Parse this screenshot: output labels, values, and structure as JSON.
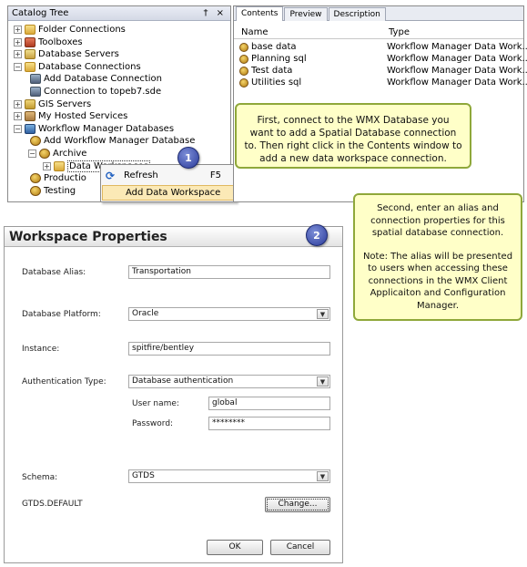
{
  "catalog": {
    "header_title": "Catalog Tree",
    "header_icons": "† ×",
    "items": [
      {
        "expander": "+",
        "icon": "folder",
        "label": "Folder Connections"
      },
      {
        "expander": "+",
        "icon": "toolbox",
        "label": "Toolboxes"
      },
      {
        "expander": "+",
        "icon": "dbserver",
        "label": "Database Servers"
      },
      {
        "expander": "−",
        "icon": "folder",
        "label": "Database Connections"
      },
      {
        "expander": "",
        "icon": "conn",
        "label": "Add Database Connection"
      },
      {
        "expander": "",
        "icon": "conn",
        "label": "Connection to topeb7.sde"
      },
      {
        "expander": "+",
        "icon": "gis",
        "label": "GIS Servers"
      },
      {
        "expander": "+",
        "icon": "hosted",
        "label": "My Hosted Services"
      },
      {
        "expander": "−",
        "icon": "wmx",
        "label": "Workflow Manager Databases"
      },
      {
        "expander": "",
        "icon": "db",
        "label": "Add Workflow Manager Database"
      },
      {
        "expander": "−",
        "icon": "db",
        "label": "Archive"
      },
      {
        "expander": "+",
        "icon": "folder",
        "label": "Data Workspaces"
      },
      {
        "expander": "",
        "icon": "db",
        "label": "Productio"
      },
      {
        "expander": "",
        "icon": "db",
        "label": "Testing"
      }
    ]
  },
  "context_menu": {
    "refresh_label": "Refresh",
    "refresh_key": "F5",
    "add_label": "Add Data Workspace"
  },
  "contents": {
    "tabs": [
      "Contents",
      "Preview",
      "Description"
    ],
    "columns": {
      "name": "Name",
      "type": "Type"
    },
    "rows": [
      {
        "name": "base data",
        "type": "Workflow Manager Data Work..."
      },
      {
        "name": "Planning sql",
        "type": "Workflow Manager Data Work..."
      },
      {
        "name": "Test data",
        "type": "Workflow Manager Data Work..."
      },
      {
        "name": "Utilities sql",
        "type": "Workflow Manager Data Work..."
      }
    ]
  },
  "callouts": {
    "step1_number": "1",
    "step1_text": "First, connect to the WMX Database you want to add a Spatial Database connection to.  Then right click in the Contents window to add a new data workspace connection.",
    "step2_number": "2",
    "step2_text_a": "Second, enter an alias and connection properties for this spatial database connection.",
    "step2_text_b": "Note: The alias will be presented to users when accessing these connections in the WMX Client Applicaiton and Configuration Manager."
  },
  "dialog": {
    "title": "Workspace Properties",
    "alias_label": "Database Alias:",
    "alias_value": "Transportation",
    "platform_label": "Database Platform:",
    "platform_value": "Oracle",
    "instance_label": "Instance:",
    "instance_value": "spitfire/bentley",
    "auth_label": "Authentication Type:",
    "auth_value": "Database authentication",
    "username_label": "User name:",
    "username_value": "global",
    "password_label": "Password:",
    "password_value": "********",
    "schema_label": "Schema:",
    "schema_value": "GTDS",
    "default_version": "GTDS.DEFAULT",
    "change_label": "Change...",
    "ok_label": "OK",
    "cancel_label": "Cancel"
  }
}
